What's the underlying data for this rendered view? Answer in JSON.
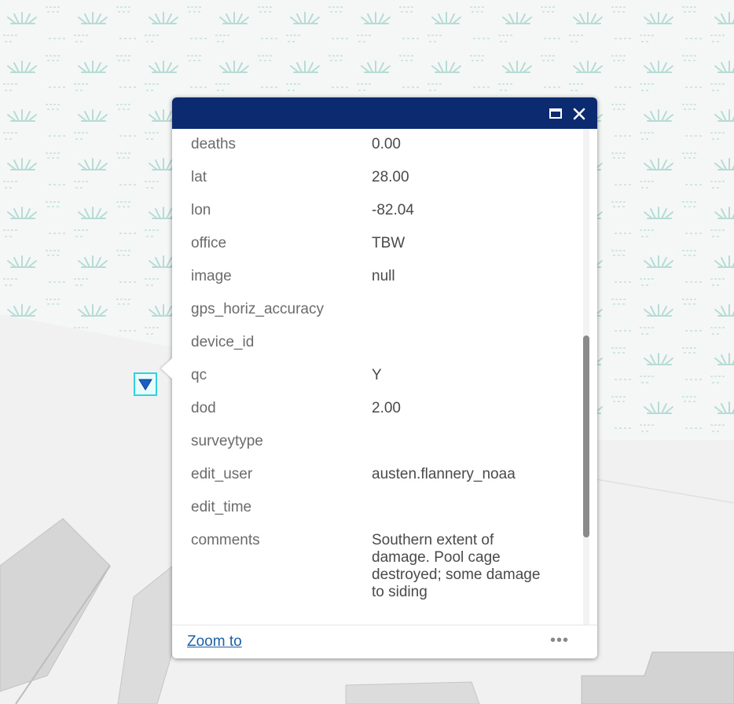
{
  "colors": {
    "titlebar": "#0b2a6f",
    "marker": "#2fd3e0",
    "link": "#1f5fa8",
    "pattern": "#bfe3dc"
  },
  "popup": {
    "title": "",
    "maximize_icon": "maximize-icon",
    "close_icon": "close-icon",
    "fields": [
      {
        "key": "deaths",
        "value": "0.00"
      },
      {
        "key": "lat",
        "value": "28.00"
      },
      {
        "key": "lon",
        "value": "-82.04"
      },
      {
        "key": "office",
        "value": "TBW"
      },
      {
        "key": "image",
        "value": "null"
      },
      {
        "key": "gps_horiz_accuracy",
        "value": ""
      },
      {
        "key": "device_id",
        "value": ""
      },
      {
        "key": "qc",
        "value": "Y"
      },
      {
        "key": "dod",
        "value": "2.00"
      },
      {
        "key": "surveytype",
        "value": ""
      },
      {
        "key": "edit_user",
        "value": "austen.flannery_noaa"
      },
      {
        "key": "edit_time",
        "value": ""
      },
      {
        "key": "comments",
        "value": "Southern extent of damage. Pool cage destroyed; some damage to siding"
      }
    ],
    "footer": {
      "zoom_label": "Zoom to",
      "more_label": "•••"
    }
  },
  "map": {
    "marker_icon": "triangle-down-icon"
  }
}
